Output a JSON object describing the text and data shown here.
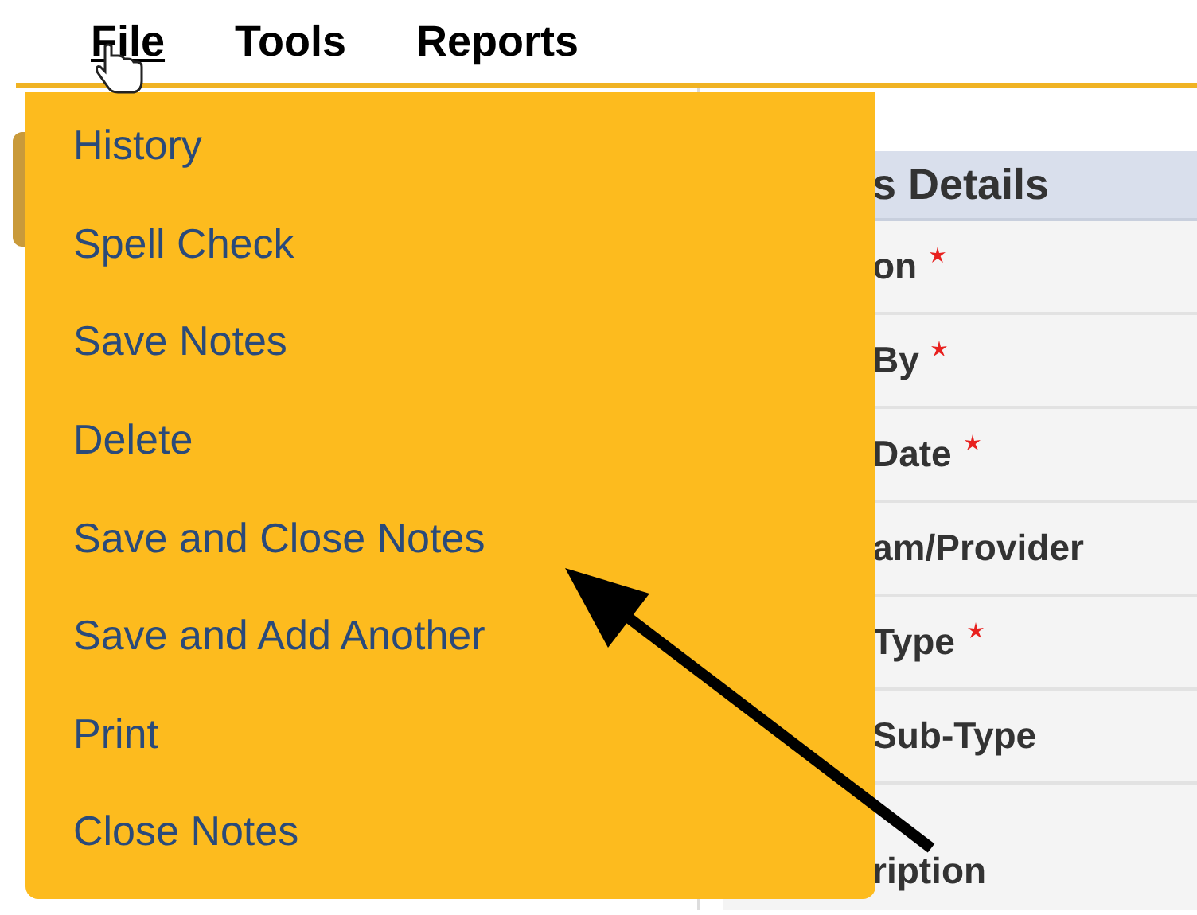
{
  "menu_bar": [
    {
      "label": "File",
      "selected": true
    },
    {
      "label": "Tools",
      "selected": false
    },
    {
      "label": "Reports",
      "selected": false
    }
  ],
  "file_menu": {
    "items": [
      "History",
      "Spell Check",
      "Save Notes",
      "Delete",
      "Save and Close Notes",
      "Save and Add Another",
      "Print",
      "Close Notes"
    ]
  },
  "details_panel": {
    "title": "s Details",
    "fields": [
      {
        "label": "on",
        "required": true
      },
      {
        "label": "By",
        "required": true
      },
      {
        "label": "Date",
        "required": true
      },
      {
        "label": "am/Provider",
        "required": false
      },
      {
        "label": "Type",
        "required": true
      },
      {
        "label": "Sub-Type",
        "required": false
      },
      {
        "label": "ription",
        "required": false
      }
    ]
  }
}
